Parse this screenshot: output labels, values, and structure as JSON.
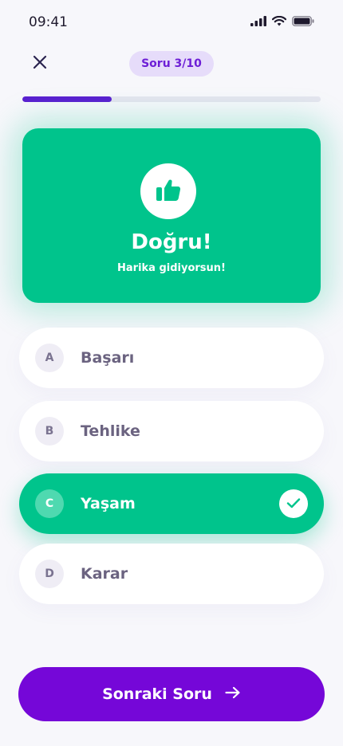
{
  "status_bar": {
    "time": "09:41"
  },
  "header": {
    "close_icon": "close-icon",
    "question_counter": "Soru 3/10",
    "progress": 0.3
  },
  "feedback": {
    "icon": "thumbs-up-icon",
    "title": "Doğru!",
    "subtitle": "Harika gidiyorsun!"
  },
  "options": [
    {
      "letter": "A",
      "label": "Başarı",
      "state": "default"
    },
    {
      "letter": "B",
      "label": "Tehlike",
      "state": "default"
    },
    {
      "letter": "C",
      "label": "Yaşam",
      "state": "correct"
    },
    {
      "letter": "D",
      "label": "Karar",
      "state": "default"
    }
  ],
  "next_button": {
    "label": "Sonraki Soru",
    "icon": "arrow-right-icon"
  },
  "colors": {
    "accent": "#7507d8",
    "progress": "#5a1fd1",
    "correct": "#00c48c",
    "pill_bg": "#e6dcfa"
  }
}
